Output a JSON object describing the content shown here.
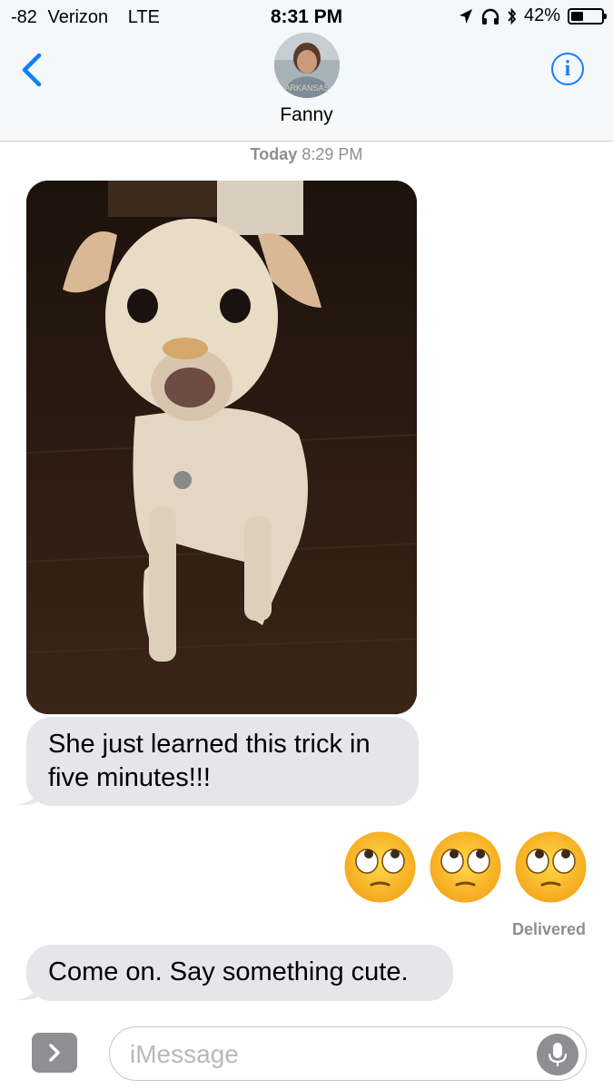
{
  "status_bar": {
    "signal": "-82",
    "carrier": "Verizon",
    "network": "LTE",
    "time": "8:31 PM",
    "battery_percent": "42%",
    "battery_level": 0.42,
    "icons": [
      "location-arrow-icon",
      "headphones-icon",
      "bluetooth-icon"
    ]
  },
  "header": {
    "back_icon": "chevron-left-icon",
    "info_icon": "info-icon",
    "info_label": "i",
    "contact_name": "Fanny",
    "accent_color": "#147efb"
  },
  "conversation": {
    "timestamp_day": "Today",
    "timestamp_time": "8:29 PM",
    "messages": [
      {
        "type": "image",
        "direction": "incoming",
        "content": "photo of a dog balancing a treat on its nose"
      },
      {
        "type": "text",
        "direction": "incoming",
        "text": "She just learned this trick in five minutes!!!"
      },
      {
        "type": "emoji",
        "direction": "outgoing",
        "emoji": [
          "🙄",
          "🙄",
          "🙄"
        ]
      },
      {
        "type": "text",
        "direction": "incoming",
        "text": "Come on. Say something cute."
      }
    ],
    "delivered_label": "Delivered",
    "incoming_bubble_color": "#e5e5ea"
  },
  "input_bar": {
    "placeholder": "iMessage",
    "value": "",
    "expand_icon": "chevron-right-icon",
    "mic_icon": "microphone-icon"
  }
}
